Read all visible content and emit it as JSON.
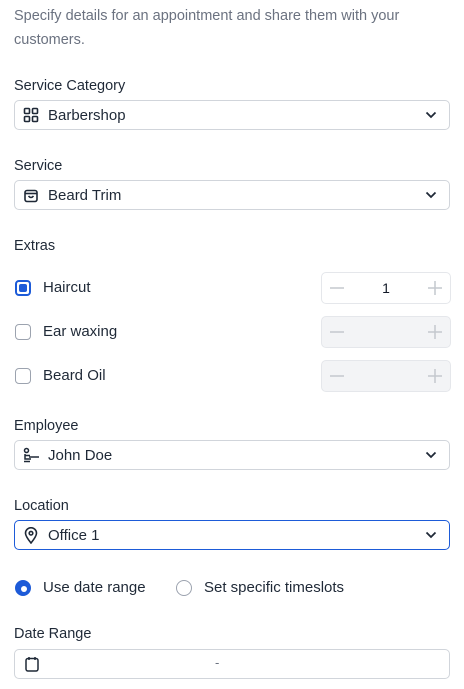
{
  "description": "Specify details for an appointment and share them with your customers.",
  "service_category": {
    "label": "Service Category",
    "value": "Barbershop",
    "icon": "grid-icon"
  },
  "service": {
    "label": "Service",
    "value": "Beard Trim",
    "icon": "bag-icon"
  },
  "extras": {
    "label": "Extras",
    "items": [
      {
        "label": "Haircut",
        "checked": true,
        "quantity": "1"
      },
      {
        "label": "Ear waxing",
        "checked": false,
        "quantity": ""
      },
      {
        "label": "Beard Oil",
        "checked": false,
        "quantity": ""
      }
    ]
  },
  "employee": {
    "label": "Employee",
    "value": "John Doe",
    "icon": "person-desk-icon"
  },
  "location": {
    "label": "Location",
    "value": "Office 1",
    "icon": "map-pin-icon"
  },
  "schedule": {
    "options": [
      {
        "label": "Use date range",
        "selected": true
      },
      {
        "label": "Set specific timeslots",
        "selected": false
      }
    ]
  },
  "date_range": {
    "label": "Date Range",
    "separator": "-",
    "icon": "calendar-icon"
  },
  "colors": {
    "accent": "#1d5bd8",
    "border": "#d1d5db",
    "muted": "#6b7280"
  }
}
